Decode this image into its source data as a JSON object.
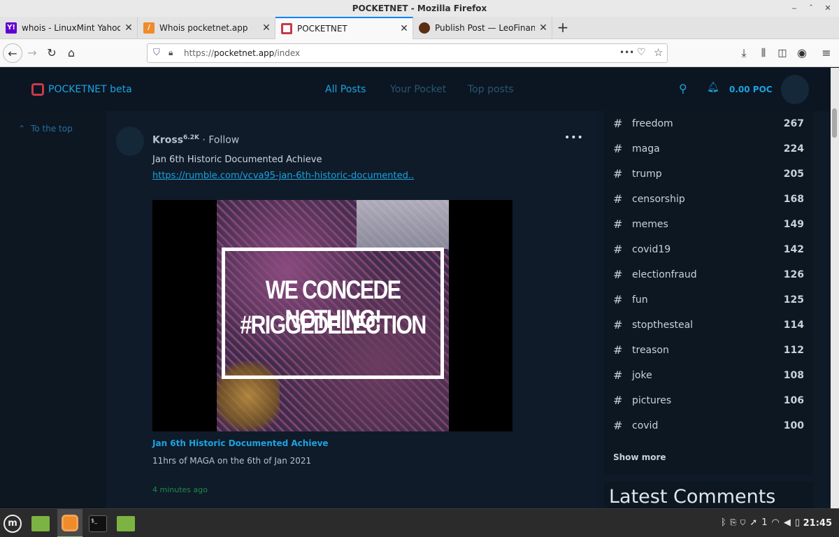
{
  "window": {
    "title": "POCKETNET - Mozilla Firefox"
  },
  "tabs": [
    {
      "label": "whois - LinuxMint Yahoo Se",
      "favicon": "Y!",
      "favicon_color": "#6001d2",
      "icon": "yahoo-favicon"
    },
    {
      "label": "Whois pocketnet.app",
      "favicon": "/",
      "favicon_color": "#f08b2a",
      "icon": "whois-favicon"
    },
    {
      "label": "POCKETNET",
      "favicon": "",
      "favicon_color": "#c63a4a",
      "icon": "pocketnet-favicon",
      "active": true
    },
    {
      "label": "Publish Post — LeoFinance",
      "favicon": "",
      "favicon_color": "#5a2e12",
      "icon": "leofinance-favicon"
    }
  ],
  "toolbar": {
    "url_prefix": "https://",
    "url_host": "pocketnet.app",
    "url_path": "/index",
    "page_actions": "•••"
  },
  "site": {
    "logo_text": "POCKETNET beta",
    "nav": [
      {
        "label": "All Posts",
        "color": "#1ca3e0"
      },
      {
        "label": "Your Pocket",
        "color": "#2a5572"
      },
      {
        "label": "Top posts",
        "color": "#2a5572"
      }
    ],
    "balance": "0.00 POC",
    "to_the_top": "To the top"
  },
  "post": {
    "author": "Kross",
    "reputation": "6.2K",
    "follow": "· Follow",
    "more": "•••",
    "text": "Jan 6th Historic Documented Achieve",
    "link": "https://rumble.com/vcva95-jan-6th-historic-documented..",
    "image_line1": "WE CONCEDE NOTHING!",
    "image_line2": "#RIGGEDELECTION",
    "embed_title": "Jan 6th Historic Documented Achieve",
    "embed_desc": "11hrs of MAGA on the 6th of Jan 2021",
    "time": "4 minutes ago"
  },
  "tags": [
    {
      "name": "freedom",
      "count": "267"
    },
    {
      "name": "maga",
      "count": "224"
    },
    {
      "name": "trump",
      "count": "205"
    },
    {
      "name": "censorship",
      "count": "168"
    },
    {
      "name": "memes",
      "count": "149"
    },
    {
      "name": "covid19",
      "count": "142"
    },
    {
      "name": "electionfraud",
      "count": "126"
    },
    {
      "name": "fun",
      "count": "125"
    },
    {
      "name": "stopthesteal",
      "count": "114"
    },
    {
      "name": "treason",
      "count": "112"
    },
    {
      "name": "joke",
      "count": "108"
    },
    {
      "name": "pictures",
      "count": "106"
    },
    {
      "name": "covid",
      "count": "100"
    }
  ],
  "tag_symbol": "#",
  "show_more": "Show more",
  "latest_comments": "Latest Comments",
  "taskbar": {
    "workspace": "1",
    "clock": "21:45",
    "terminal_glyph": "$_"
  }
}
